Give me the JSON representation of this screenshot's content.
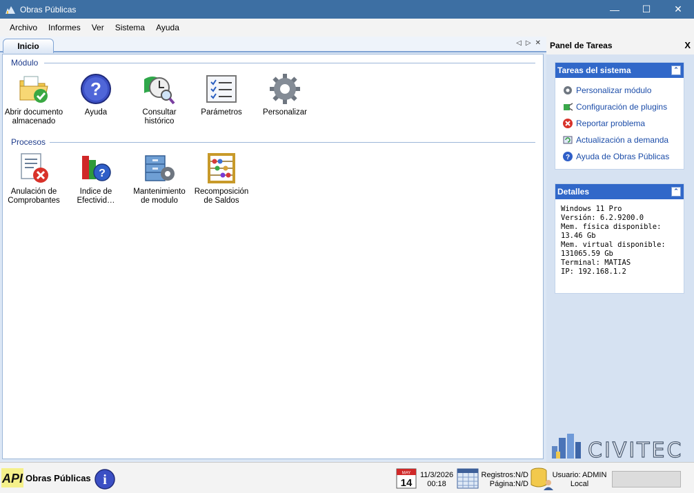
{
  "window": {
    "title": "Obras Públicas",
    "minimize": "—",
    "maximize": "☐",
    "close": "✕"
  },
  "menu": [
    "Archivo",
    "Informes",
    "Ver",
    "Sistema",
    "Ayuda"
  ],
  "tabs": {
    "active": "Inicio"
  },
  "modulo": {
    "heading": "Módulo",
    "items": [
      {
        "label": "Abrir documento almacenado",
        "icon": "folder-check-icon"
      },
      {
        "label": "Ayuda",
        "icon": "help-icon"
      },
      {
        "label": "Consultar histórico",
        "icon": "clock-search-icon"
      },
      {
        "label": "Parámetros",
        "icon": "checklist-icon"
      },
      {
        "label": "Personalizar",
        "icon": "gear-icon"
      }
    ]
  },
  "procesos": {
    "heading": "Procesos",
    "items": [
      {
        "label": "Anulación de Comprobantes",
        "icon": "document-cancel-icon"
      },
      {
        "label": "Indice de Efectivid…",
        "icon": "bar-chart-help-icon"
      },
      {
        "label": "Mantenimiento de modulo",
        "icon": "cabinet-gear-icon"
      },
      {
        "label": "Recomposición de Saldos",
        "icon": "abacus-icon"
      }
    ]
  },
  "taskpane": {
    "title": "Panel de Tareas",
    "close": "X",
    "system_group": {
      "title": "Tareas del sistema",
      "tasks": [
        {
          "label": "Personalizar módulo",
          "icon": "gear-icon"
        },
        {
          "label": "Configuración de plugins",
          "icon": "plugin-icon"
        },
        {
          "label": "Reportar problema",
          "icon": "error-icon"
        },
        {
          "label": "Actualización a demanda",
          "icon": "update-icon"
        },
        {
          "label": "Ayuda de Obras Públicas",
          "icon": "help-icon"
        }
      ]
    },
    "details_group": {
      "title": "Detalles",
      "lines": [
        "Windows 11 Pro",
        "Versión: 6.2.9200.0",
        "Mem. física disponible: 13.46 Gb",
        "Mem. virtual disponible:",
        "131065.59 Gb",
        "Terminal: MATIAS",
        "IP: 192.168.1.2"
      ]
    },
    "logo_text": "CIVITEC"
  },
  "status": {
    "brand_logo": "API",
    "brand_text": "Obras Públicas",
    "calendar_month": "MAY",
    "calendar_day": "14",
    "date": "11/3/2026",
    "time": "00:18",
    "registros": "Registros:N/D",
    "pagina": "Página:N/D",
    "usuario": "Usuario: ADMIN",
    "ubicacion": "Local"
  },
  "colors": {
    "titlebar": "#3d6fa3",
    "group_header": "#3168c9",
    "link": "#1b4ca8",
    "section": "#1e3c8c"
  }
}
